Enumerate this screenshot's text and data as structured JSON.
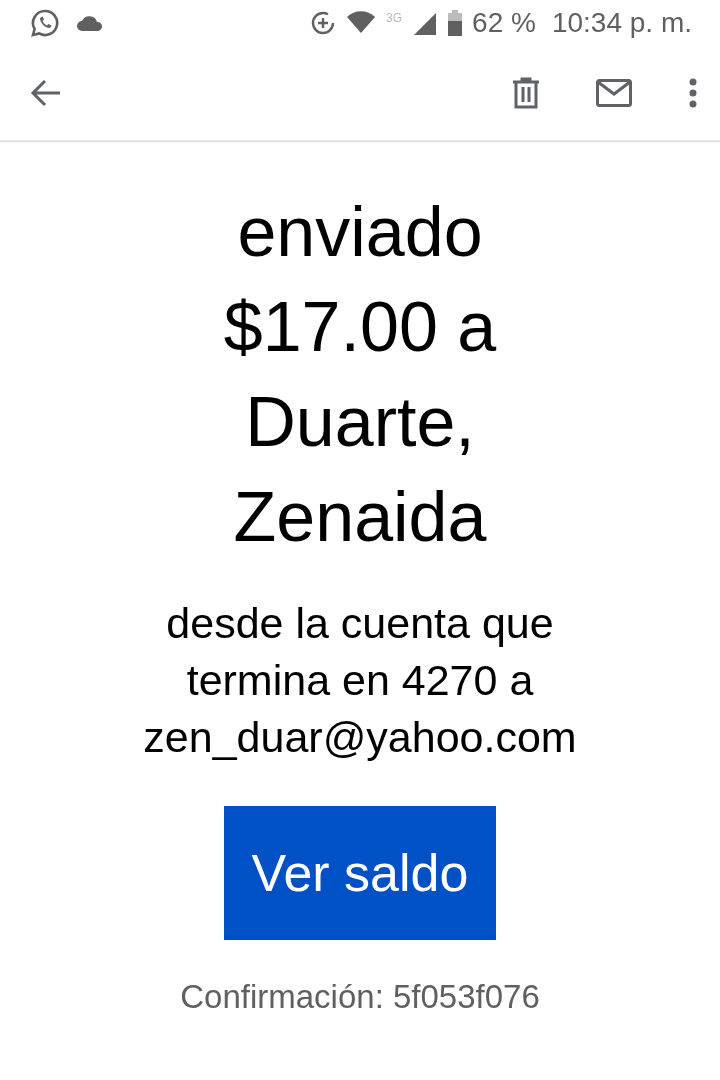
{
  "status_bar": {
    "battery": "62 %",
    "network": "3G",
    "time": "10:34 p. m."
  },
  "message": {
    "headline": "enviado $17.00 a Duarte, Zenaida",
    "detail": "desde la cuenta que termina en 4270 a zen_duar@yahoo.com",
    "button": "Ver saldo",
    "confirmation": "Confirmación: 5f053f076"
  }
}
